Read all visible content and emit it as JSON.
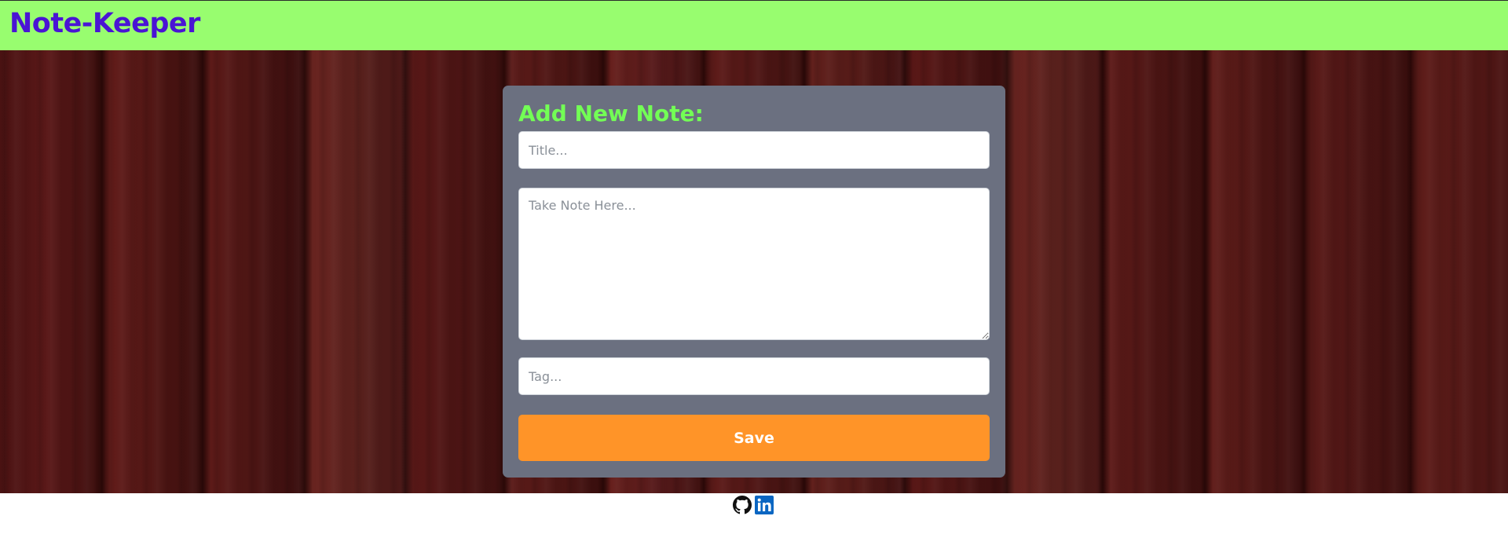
{
  "header": {
    "title": "Note-Keeper",
    "background_color": "#98fd6f",
    "title_color": "#4a14d4"
  },
  "form": {
    "heading": "Add New Note:",
    "heading_color": "#73ff55",
    "title_placeholder": "Title...",
    "title_value": "",
    "note_placeholder": "Take Note Here...",
    "note_value": "",
    "tag_placeholder": "Tag...",
    "tag_value": "",
    "save_label": "Save",
    "save_color": "#ff9428",
    "card_color": "#6b7080"
  },
  "footer": {
    "links": [
      {
        "icon": "github-icon"
      },
      {
        "icon": "linkedin-icon",
        "color": "#0a66c2"
      }
    ]
  }
}
